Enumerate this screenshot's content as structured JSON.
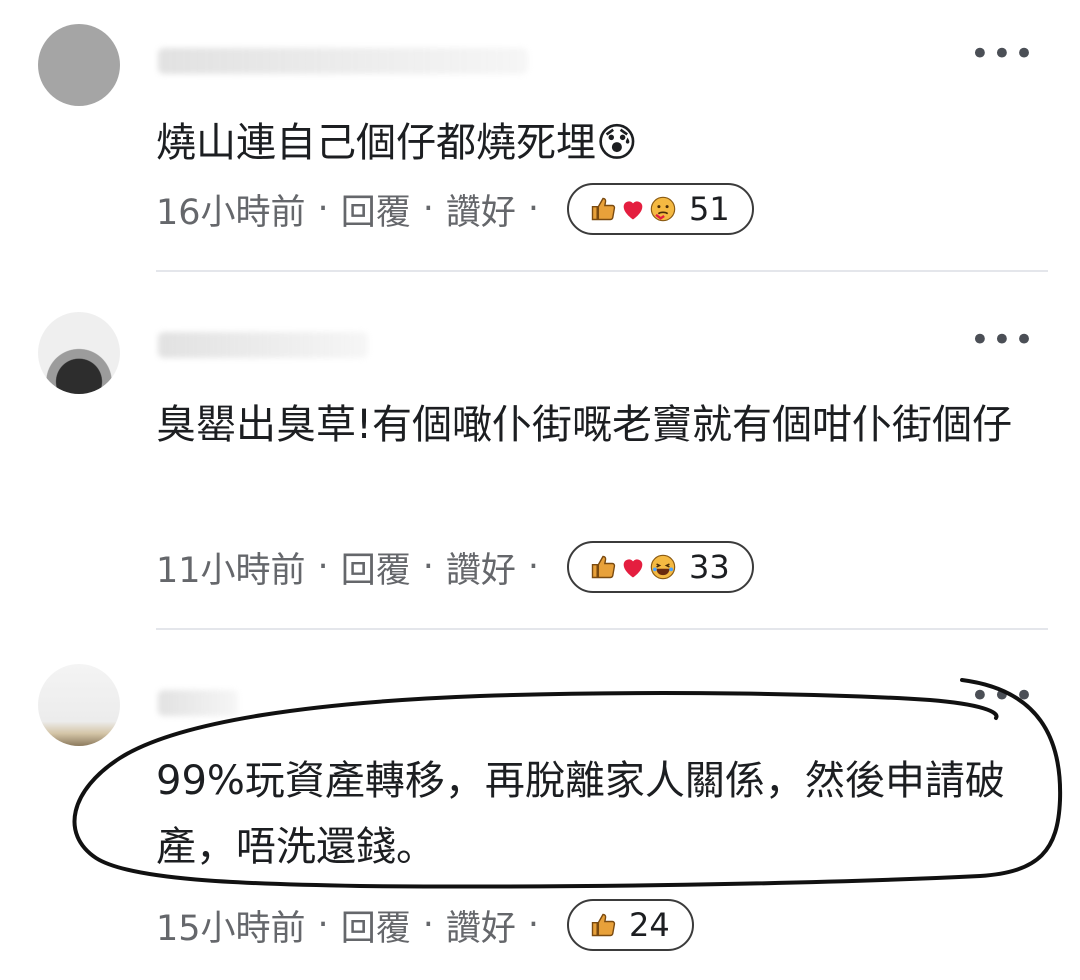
{
  "comments": [
    {
      "text": "燒山連自己個仔都燒死埋😰",
      "time": "16小時前",
      "reply_label": "回覆",
      "like_label": "讚好",
      "reactions": [
        "like-icon",
        "love-icon",
        "care-icon"
      ],
      "reaction_count": "51"
    },
    {
      "text": "臭罌出臭草!有個噉仆街嘅老竇就有個咁仆街個仔",
      "time": "11小時前",
      "reply_label": "回覆",
      "like_label": "讚好",
      "reactions": [
        "like-icon",
        "love-icon",
        "haha-icon"
      ],
      "reaction_count": "33"
    },
    {
      "text": "99%玩資產轉移，再脫離家人關係，然後申請破產，唔洗還錢。",
      "time": "15小時前",
      "reply_label": "回覆",
      "like_label": "讚好",
      "reactions": [
        "like-icon"
      ],
      "reaction_count": "24"
    }
  ],
  "separator": "·",
  "more_glyph": "•••",
  "colors": {
    "meta_text": "#65676b",
    "body_text": "#1c1e21",
    "like_orange": "#e8a13a",
    "love_red": "#e41e3f",
    "annotation_ink": "#111111"
  }
}
